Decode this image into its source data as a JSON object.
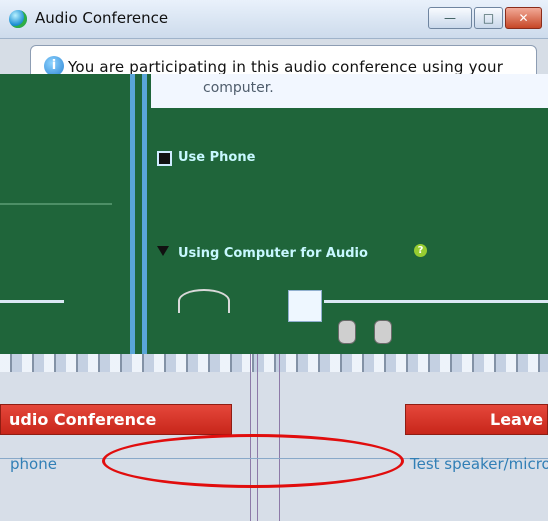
{
  "window": {
    "title": "Audio Conference",
    "minimize_label": "—",
    "maximize_label": "□",
    "close_label": "✕"
  },
  "info": {
    "message": "You are participating in this audio conference using your",
    "message_cont": "computer.",
    "icon": "info-icon"
  },
  "options": {
    "use_phone_label": "Use Phone",
    "using_computer_label": "Using Computer for Audio",
    "help_icon": "help-icon"
  },
  "buttons": {
    "audio_conference_label": "udio Conference",
    "leave_label": "Leave A"
  },
  "links": {
    "phone_label": "phone",
    "test_label": "Test speaker/micro"
  },
  "colors": {
    "accent_green": "#1f653a",
    "button_red": "#d32b1f",
    "annotation_red": "#e10d0d"
  }
}
